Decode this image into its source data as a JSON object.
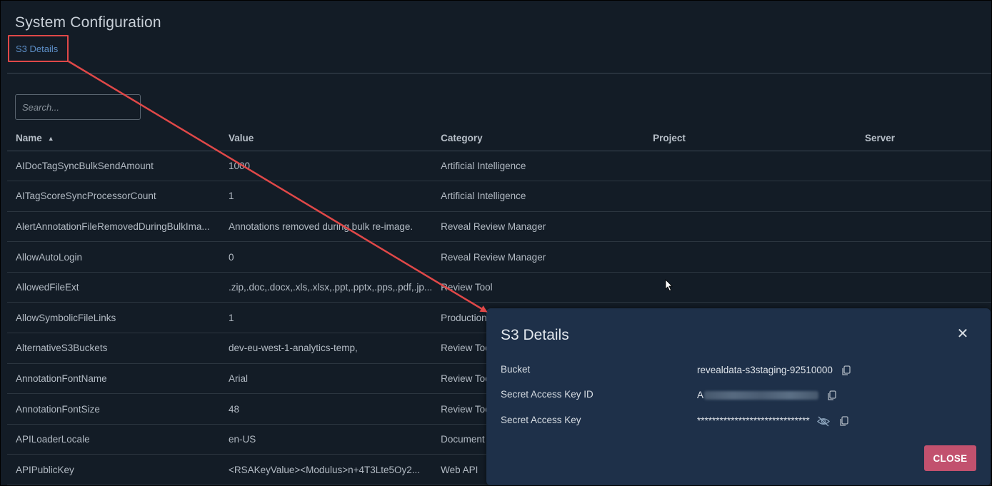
{
  "page": {
    "title": "System Configuration",
    "tab": "S3 Details"
  },
  "search": {
    "placeholder": "Search..."
  },
  "table": {
    "headers": {
      "name": "Name",
      "value": "Value",
      "category": "Category",
      "project": "Project",
      "server": "Server"
    },
    "sort_icon": "sort-ascending-icon",
    "rows": [
      {
        "name": "AIDocTagSyncBulkSendAmount",
        "value": "1000",
        "category": "Artificial Intelligence",
        "project": "",
        "server": ""
      },
      {
        "name": "AITagScoreSyncProcessorCount",
        "value": "1",
        "category": "Artificial Intelligence",
        "project": "",
        "server": ""
      },
      {
        "name": "AlertAnnotationFileRemovedDuringBulkIma...",
        "value": "Annotations removed during bulk re-image.",
        "category": "Reveal Review Manager",
        "project": "",
        "server": ""
      },
      {
        "name": "AllowAutoLogin",
        "value": "0",
        "category": "Reveal Review Manager",
        "project": "",
        "server": ""
      },
      {
        "name": "AllowedFileExt",
        "value": ".zip,.doc,.docx,.xls,.xlsx,.ppt,.pptx,.pps,.pdf,.jp...",
        "category": "Review Tool",
        "project": "",
        "server": ""
      },
      {
        "name": "AllowSymbolicFileLinks",
        "value": "1",
        "category": "Production",
        "project": "",
        "server": ""
      },
      {
        "name": "AlternativeS3Buckets",
        "value": "dev-eu-west-1-analytics-temp,",
        "category": "Review Tool",
        "project": "",
        "server": ""
      },
      {
        "name": "AnnotationFontName",
        "value": "Arial",
        "category": "Review Tool",
        "project": "",
        "server": ""
      },
      {
        "name": "AnnotationFontSize",
        "value": "48",
        "category": "Review Tool",
        "project": "",
        "server": ""
      },
      {
        "name": "APILoaderLocale",
        "value": "en-US",
        "category": "Document",
        "project": "",
        "server": ""
      },
      {
        "name": "APIPublicKey",
        "value": "<RSAKeyValue><Modulus>n+4T3Lte5Oy2...",
        "category": "Web API",
        "project": "",
        "server": ""
      }
    ]
  },
  "modal": {
    "title": "S3 Details",
    "close_icon": "close-icon",
    "fields": {
      "bucket": {
        "label": "Bucket",
        "value": "revealdata-s3staging-92510000"
      },
      "key_id": {
        "label": "Secret Access Key ID",
        "value": "A"
      },
      "secret": {
        "label": "Secret Access Key",
        "value": "******************************"
      }
    },
    "close_button": "CLOSE"
  },
  "colors": {
    "background": "#131c26",
    "modal_background": "#1e3049",
    "link": "#5d8fc8",
    "annotation_red": "#e04848",
    "close_button": "#c2516e"
  }
}
